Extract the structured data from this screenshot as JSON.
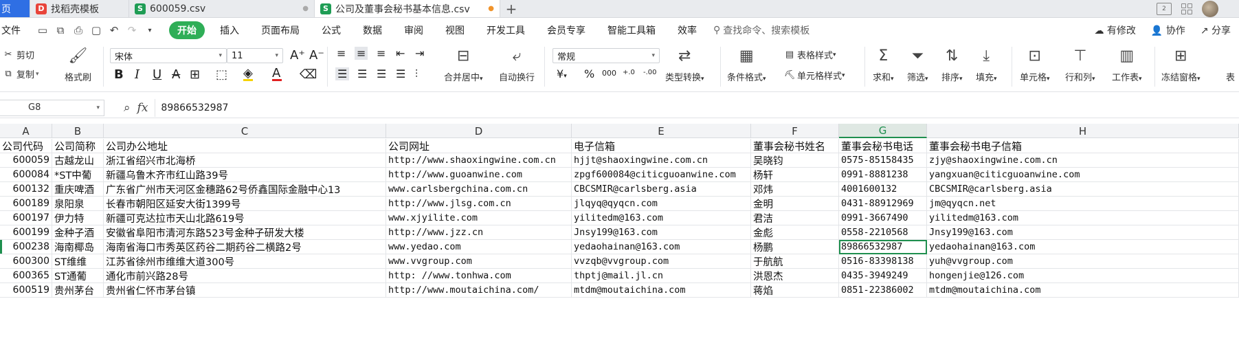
{
  "tabs": [
    {
      "label": "页",
      "icon": "",
      "active": false
    },
    {
      "label": "找稻壳模板",
      "icon": "docer-icon",
      "active": false
    },
    {
      "label": "600059.csv",
      "icon": "sheet-icon",
      "active": false
    },
    {
      "label": "公司及董事会秘书基本信息.csv",
      "icon": "sheet-icon",
      "active": true
    }
  ],
  "tab_add": "+",
  "menu": {
    "file": "文件",
    "start": "开始",
    "items": [
      "插入",
      "页面布局",
      "公式",
      "数据",
      "审阅",
      "视图",
      "开发工具",
      "会员专享",
      "智能工具箱",
      "效率"
    ],
    "search_placeholder": "查找命令、搜索模板",
    "right": [
      "有修改",
      "协作",
      "分享"
    ]
  },
  "ribbon": {
    "cut": "剪切",
    "copy": "复制",
    "format_painter": "格式刷",
    "font_name": "宋体",
    "font_size": "11",
    "merge_center": "合并居中",
    "wrap_text": "自动换行",
    "number_format": "常规",
    "type_convert": "类型转换",
    "cond_format": "条件格式",
    "table_style": "表格样式",
    "cell_style": "单元格样式",
    "sum": "求和",
    "filter": "筛选",
    "sort": "排序",
    "fill": "填充",
    "cell": "单元格",
    "row_col": "行和列",
    "worksheet": "工作表",
    "freeze": "冻结窗格",
    "table_tools": "表",
    "currency": "¥",
    "percent": "%",
    "thousands": "000",
    "inc_decimal": "+.0",
    "dec_decimal": "-.00"
  },
  "formula_bar": {
    "name_box": "G8",
    "fx": "fx",
    "value": "89866532987"
  },
  "columns": [
    "A",
    "B",
    "C",
    "D",
    "E",
    "F",
    "G",
    "H"
  ],
  "selected_column": "G",
  "header_row": [
    "公司代码",
    "公司简称",
    "公司办公地址",
    "公司网址",
    "电子信箱",
    "董事会秘书姓名",
    "董事会秘书电话",
    "董事会秘书电子信箱"
  ],
  "rows": [
    [
      "600059",
      "古越龙山",
      "浙江省绍兴市北海桥",
      "http://www.shaoxingwine.com.cn",
      "hjjt@shaoxingwine.com.cn",
      "吴晓钧",
      "0575-85158435",
      "zjy@shaoxingwine.com.cn"
    ],
    [
      "600084",
      "*ST中葡",
      "新疆乌鲁木齐市红山路39号",
      "http://www.guoanwine.com",
      "zpgf600084@citicguoanwine.com",
      "杨轩",
      "0991-8881238",
      "yangxuan@citicguoanwine.com"
    ],
    [
      "600132",
      "重庆啤酒",
      "广东省广州市天河区金穗路62号侨鑫国际金融中心13",
      "www.carlsbergchina.com.cn",
      "CBCSMIR@carlsberg.asia",
      "邓炜",
      "4001600132",
      "CBCSMIR@carlsberg.asia"
    ],
    [
      "600189",
      "泉阳泉",
      "长春市朝阳区延安大街1399号",
      "http://www.jlsg.com.cn",
      "jlqyq@qyqcn.com",
      "金明",
      "0431-88912969",
      "jm@qyqcn.net"
    ],
    [
      "600197",
      "伊力特",
      "新疆可克达拉市天山北路619号",
      "www.xjyilite.com",
      "yilitedm@163.com",
      "君洁",
      "0991-3667490",
      "yilitedm@163.com"
    ],
    [
      "600199",
      "金种子酒",
      "安徽省阜阳市清河东路523号金种子研发大楼",
      "http://www.jzz.cn",
      "Jnsy199@163.com",
      "金彪",
      "0558-2210568",
      "Jnsy199@163.com"
    ],
    [
      "600238",
      "海南椰岛",
      "海南省海口市秀英区药谷二期药谷二横路2号",
      "www.yedao.com",
      "yedaohainan@163.com",
      "杨鹏",
      "89866532987",
      "yedaohainan@163.com"
    ],
    [
      "600300",
      "ST维维",
      "江苏省徐州市维维大道300号",
      "www.vvgroup.com",
      "vvzqb@vvgroup.com",
      "于航航",
      "0516-83398138",
      "yuh@vvgroup.com"
    ],
    [
      "600365",
      "ST通葡",
      "通化市前兴路28号",
      "http: //www.tonhwa.com",
      "thptj@mail.jl.cn",
      "洪恩杰",
      "0435-3949249",
      "hongenjie@126.com"
    ],
    [
      "600519",
      "贵州茅台",
      "贵州省仁怀市茅台镇",
      "http://www.moutaichina.com/",
      "mtdm@moutaichina.com",
      "蒋焰",
      "0851-22386002",
      "mtdm@moutaichina.com"
    ]
  ],
  "selected_row_index": 6,
  "accent_color": "#1e8f4e",
  "start_button_color": "#2fae57"
}
